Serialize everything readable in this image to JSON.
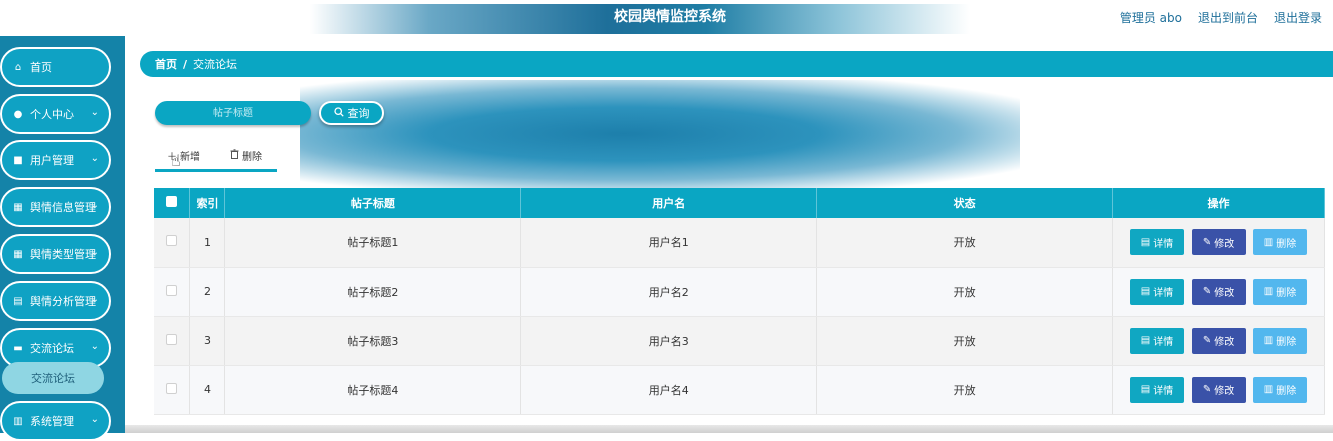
{
  "header": {
    "title": "校园舆情监控系统",
    "admin_label": "管理员 abo",
    "back_front": "退出到前台",
    "logout": "退出登录"
  },
  "sidebar": {
    "items": [
      {
        "label": "首页",
        "icon": "home-icon",
        "glyph": "⌂",
        "chev": ""
      },
      {
        "label": "个人中心",
        "icon": "user-icon",
        "glyph": "●",
        "chev": "⌄"
      },
      {
        "label": "用户管理",
        "icon": "user-manage-icon",
        "glyph": "■",
        "chev": "⌄"
      },
      {
        "label": "舆情信息管理",
        "icon": "grid-icon",
        "glyph": "▦",
        "chev": "⌄"
      },
      {
        "label": "舆情类型管理",
        "icon": "grid-icon",
        "glyph": "▦",
        "chev": "⌄"
      },
      {
        "label": "舆情分析管理",
        "icon": "clipboard-icon",
        "glyph": "▤",
        "chev": "⌄"
      },
      {
        "label": "交流论坛",
        "icon": "monitor-icon",
        "glyph": "▬",
        "chev": "⌄"
      },
      {
        "label": "系统管理",
        "icon": "book-icon",
        "glyph": "▥",
        "chev": "⌄"
      }
    ],
    "sub_item": "交流论坛"
  },
  "breadcrumb": {
    "home": "首页",
    "separator": "/",
    "current": "交流论坛"
  },
  "search": {
    "placeholder": "帖子标题",
    "button_label": "查询"
  },
  "actions": {
    "add_label": "新增",
    "delete_label": "删除"
  },
  "table": {
    "columns": [
      "索引",
      "帖子标题",
      "用户名",
      "状态",
      "操作"
    ],
    "rows": [
      {
        "index": "1",
        "title": "帖子标题1",
        "user": "用户名1",
        "status": "开放"
      },
      {
        "index": "2",
        "title": "帖子标题2",
        "user": "用户名2",
        "status": "开放"
      },
      {
        "index": "3",
        "title": "帖子标题3",
        "user": "用户名3",
        "status": "开放"
      },
      {
        "index": "4",
        "title": "帖子标题4",
        "user": "用户名4",
        "status": "开放"
      }
    ],
    "row_buttons": {
      "detail": "详情",
      "edit": "修改",
      "delete": "删除"
    }
  },
  "colors": {
    "accent": "#0aa6c3",
    "sidebar_bg": "#1483a8",
    "edit_btn": "#3a52a8",
    "delete_btn": "#52b7ee"
  }
}
